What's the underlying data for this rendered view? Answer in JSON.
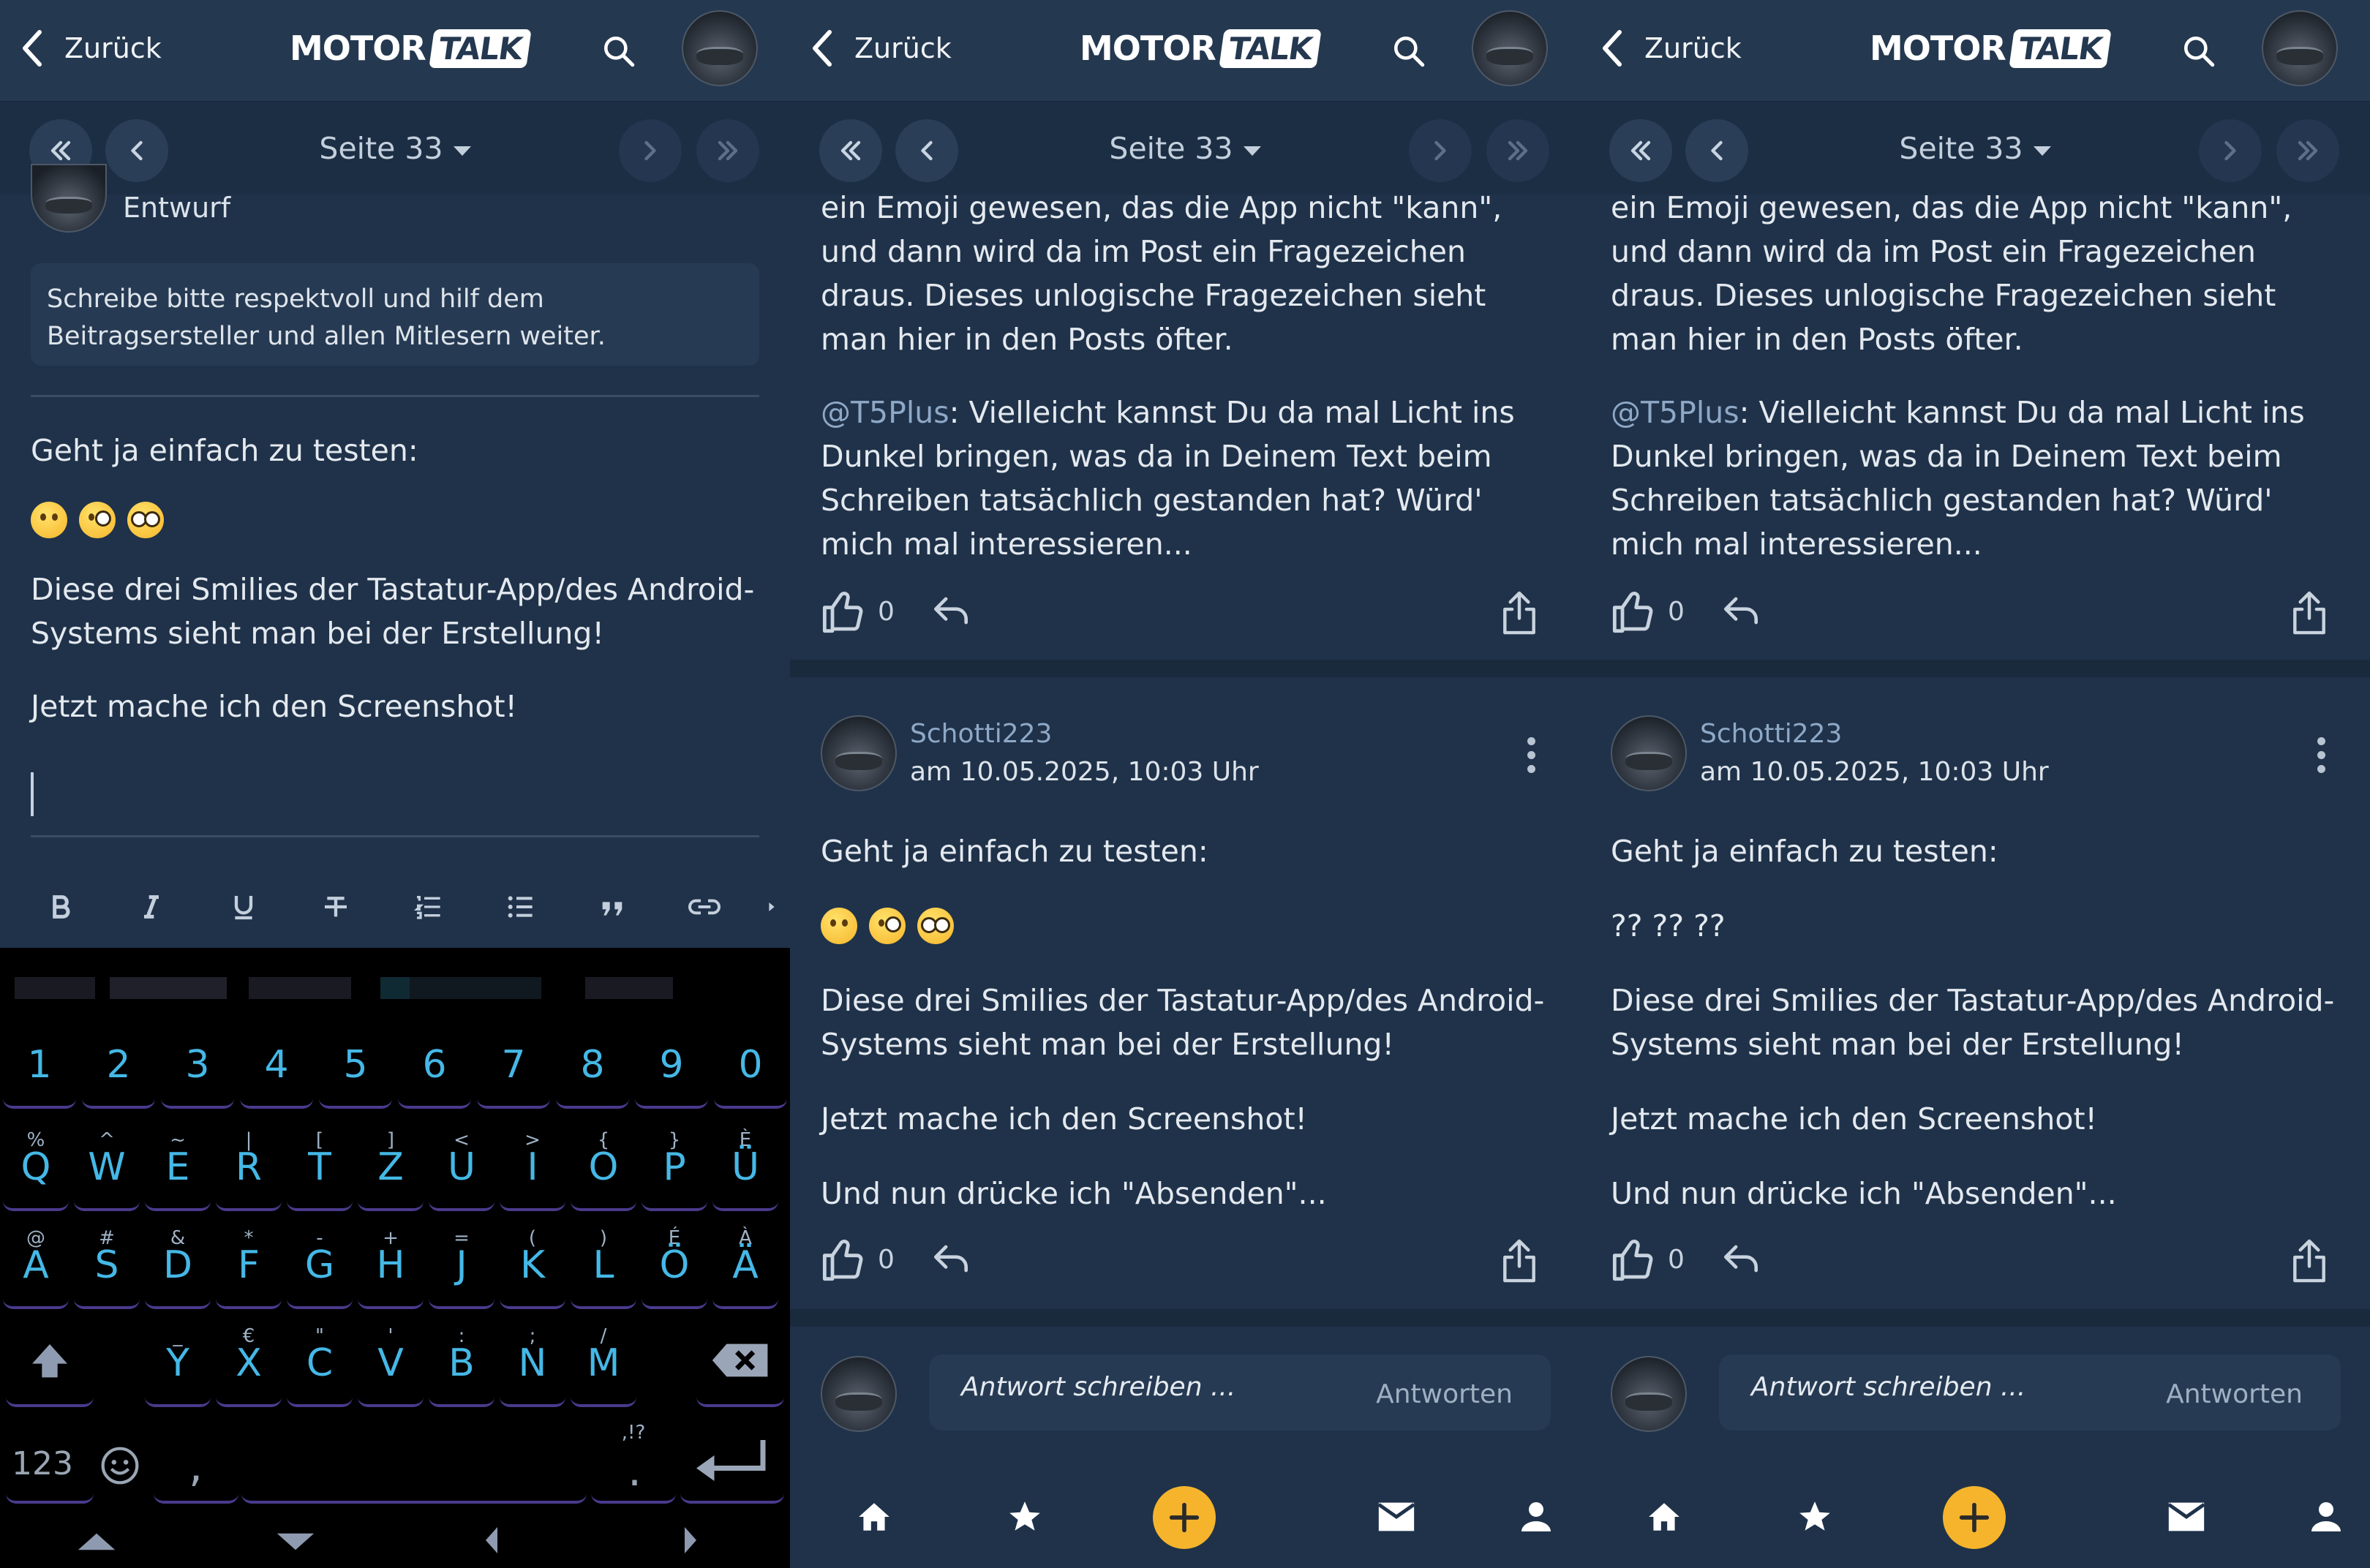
{
  "app": {
    "back_label": "Zurück",
    "logo_part1": "MOTOR",
    "logo_part2": "TALK",
    "page_label": "Seite 33",
    "accent_color": "#f5b42c"
  },
  "editor": {
    "draft_label": "Entwurf",
    "hint": "Schreibe bitte respektvoll und hilf dem Beitragsersteller und allen Mitlesern weiter.",
    "line1": "Geht ja einfach zu testen:",
    "line2": "Diese drei Smilies der Tastatur-App/des Android-Systems sieht man bei der Erstellung!",
    "line3": "Jetzt mache ich den Screenshot!",
    "toolbar_icons": [
      "bold-icon",
      "italic-icon",
      "underline-icon",
      "strikethrough-icon",
      "numbered-list-icon",
      "bullet-list-icon",
      "quote-icon",
      "link-icon"
    ]
  },
  "keyboard": {
    "numbers": [
      "1",
      "2",
      "3",
      "4",
      "5",
      "6",
      "7",
      "8",
      "9",
      "0"
    ],
    "row1": [
      {
        "k": "Q",
        "s": "%"
      },
      {
        "k": "W",
        "s": "^"
      },
      {
        "k": "E",
        "s": "~"
      },
      {
        "k": "R",
        "s": "|"
      },
      {
        "k": "T",
        "s": "["
      },
      {
        "k": "Z",
        "s": "]"
      },
      {
        "k": "U",
        "s": "<"
      },
      {
        "k": "I",
        "s": ">"
      },
      {
        "k": "O",
        "s": "{"
      },
      {
        "k": "P",
        "s": "}"
      },
      {
        "k": "Ü",
        "s": "È"
      }
    ],
    "row2": [
      {
        "k": "A",
        "s": "@"
      },
      {
        "k": "S",
        "s": "#"
      },
      {
        "k": "D",
        "s": "&"
      },
      {
        "k": "F",
        "s": "*"
      },
      {
        "k": "G",
        "s": "-"
      },
      {
        "k": "H",
        "s": "+"
      },
      {
        "k": "J",
        "s": "="
      },
      {
        "k": "K",
        "s": "("
      },
      {
        "k": "L",
        "s": ")"
      },
      {
        "k": "Ö",
        "s": "É"
      },
      {
        "k": "Ä",
        "s": "À"
      }
    ],
    "row3": [
      {
        "k": "Y",
        "s": "_"
      },
      {
        "k": "X",
        "s": "€"
      },
      {
        "k": "C",
        "s": "\""
      },
      {
        "k": "V",
        "s": "'"
      },
      {
        "k": "B",
        "s": ":"
      },
      {
        "k": "N",
        "s": ";"
      },
      {
        "k": "M",
        "s": "/"
      }
    ],
    "num_label": "123",
    "comma": ",",
    "period": ".",
    "period_sub": ",!?"
  },
  "thread": {
    "prev_post_text": "ein Emoji gewesen, das die App nicht \"kann\", und dann wird da im Post ein Fragezeichen draus. Dieses unlogische Fragezeichen sieht man hier in den Posts öfter.",
    "mention": "@T5Plus",
    "mention_rest": ": Vielleicht kannst Du da mal Licht ins Dunkel bringen, was da in Deinem Text beim Schreiben tatsächlich gestanden hat? Würd' mich mal interessieren...",
    "like_count": "0",
    "author": "Schotti223",
    "date": "am 10.05.2025, 10:03 Uhr",
    "post_line1": "Geht ja einfach zu testen:",
    "post_emoji_fallback": "?? ?? ??",
    "post_line2": "Diese drei Smilies der Tastatur-App/des Android-Systems sieht man bei der Erstellung!",
    "post_line3": "Jetzt mache ich den Screenshot!",
    "post_line4": "Und nun drücke ich \"Absenden\"...",
    "reply_placeholder": "Antwort schreiben ...",
    "reply_send": "Antworten"
  },
  "nav_icons": [
    "home-icon",
    "star-icon",
    "plus-icon",
    "mail-icon",
    "profile-icon"
  ]
}
